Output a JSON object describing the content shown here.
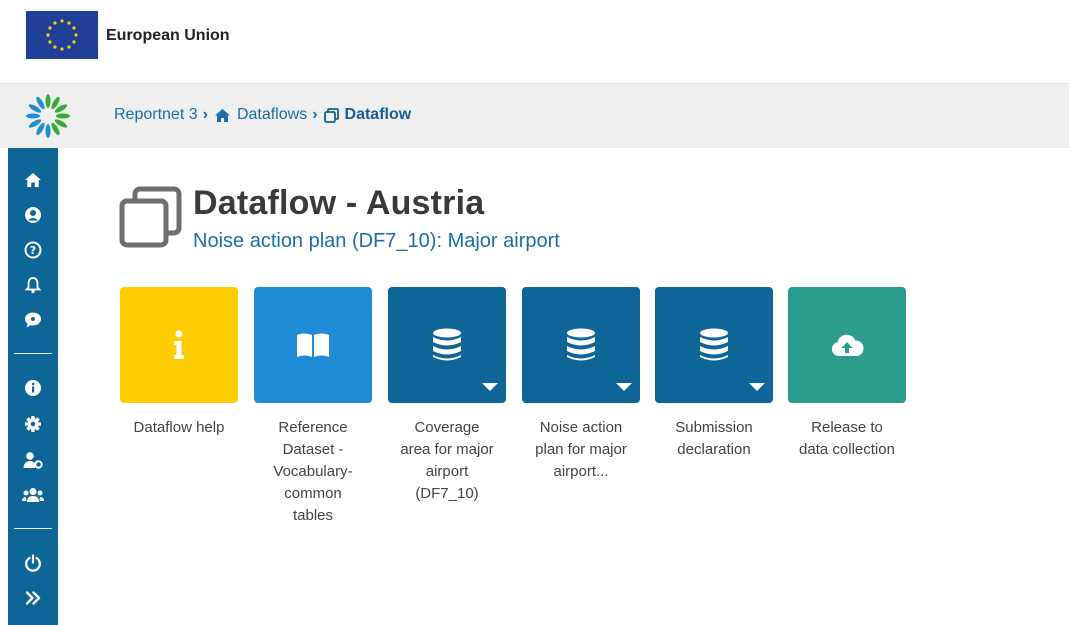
{
  "eu_header": {
    "title": "European Union"
  },
  "breadcrumb": {
    "items": [
      {
        "label": "Reportnet 3",
        "icon": "none"
      },
      {
        "label": "Dataflows",
        "icon": "home-icon"
      },
      {
        "label": "Dataflow",
        "icon": "clone-icon"
      }
    ]
  },
  "sidebar": {
    "items": [
      "home-icon",
      "user-circle-icon",
      "help-icon",
      "bell-icon",
      "comment-icon",
      "info-icon",
      "gear-icon",
      "user-cog-icon",
      "users-icon",
      "power-icon",
      "expand-icon"
    ]
  },
  "page": {
    "title": "Dataflow - Austria",
    "subtitle": "Noise action plan (DF7_10): Major airport"
  },
  "cards": [
    {
      "label": "Dataflow help",
      "color": "#ffcc00",
      "icon": "info-icon",
      "has_dropdown": false
    },
    {
      "label": "Reference Dataset - Vocabulary-common tables",
      "color": "#1f8dd6",
      "icon": "book-icon",
      "has_dropdown": false
    },
    {
      "label": "Coverage area for major airport (DF7_10)",
      "color": "#0e6598",
      "icon": "database-icon",
      "has_dropdown": true
    },
    {
      "label": "Noise action plan for major airport...",
      "color": "#0e6598",
      "icon": "database-icon",
      "has_dropdown": true
    },
    {
      "label": "Submission declaration",
      "color": "#0e6598",
      "icon": "database-icon",
      "has_dropdown": true
    },
    {
      "label": "Release to data collection",
      "color": "#2a9d8f",
      "icon": "cloud-upload-icon",
      "has_dropdown": false
    }
  ],
  "colors": {
    "primary": "#0e6598",
    "link": "#1a6fa8",
    "help": "#ffcc00",
    "reference": "#1f8dd6",
    "release": "#2a9d8f"
  }
}
